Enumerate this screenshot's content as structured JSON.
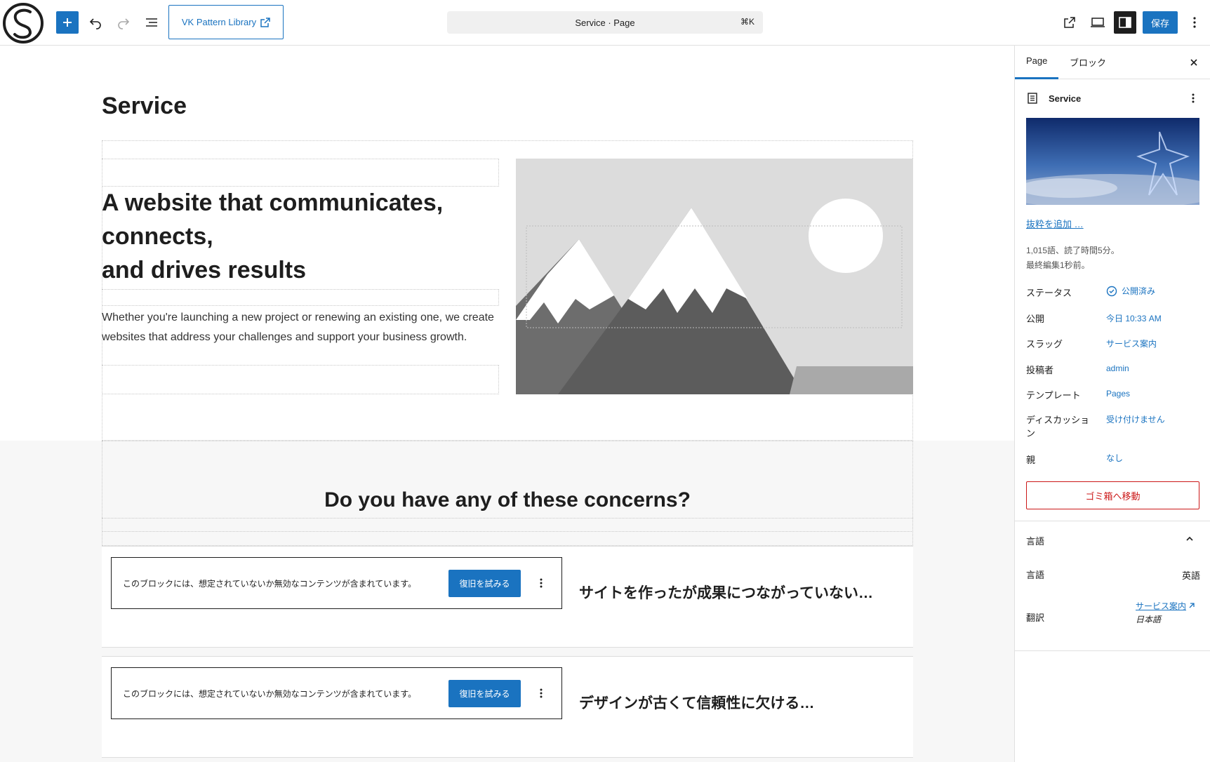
{
  "toolbar": {
    "add_label": "+",
    "vk_label": "VK Pattern Library",
    "command_title": "Service · Page",
    "command_shortcut": "⌘K",
    "save_label": "保存"
  },
  "canvas": {
    "page_title": "Service",
    "hero": {
      "heading_lines": [
        "A website that communicates,",
        "connects,",
        "and drives results"
      ],
      "paragraph": "Whether you're launching a new project or renewing an existing one, we create websites that address your challenges and support your business growth."
    },
    "concerns_heading": "Do you have any of these concerns?",
    "cards": [
      {
        "invalid_text": "このブロックには、想定されていないか無効なコンテンツが含まれています。",
        "restore_label": "復旧を試みる",
        "heading": "サイトを作ったが成果につながっていない…"
      },
      {
        "invalid_text": "このブロックには、想定されていないか無効なコンテンツが含まれています。",
        "restore_label": "復旧を試みる",
        "heading": "デザインが古くて信頼性に欠ける…"
      }
    ]
  },
  "sidebar": {
    "tabs": [
      "Page",
      "ブロック"
    ],
    "doc_title": "Service",
    "add_excerpt": "抜粋を追加 …",
    "word_count": "1,015語、読了時間5分。",
    "last_edited": "最終編集1秒前。",
    "rows": [
      {
        "label": "ステータス",
        "value": "公開済み"
      },
      {
        "label": "公開",
        "value": "今日 10:33 AM"
      },
      {
        "label": "スラッグ",
        "value": "サービス案内"
      },
      {
        "label": "投稿者",
        "value": "admin"
      },
      {
        "label": "テンプレート",
        "value": "Pages"
      },
      {
        "label": "ディスカッション",
        "value": "受け付けません"
      },
      {
        "label": "親",
        "value": "なし"
      }
    ],
    "trash_label": "ゴミ箱へ移動",
    "language_section": {
      "title": "言語",
      "language_label": "言語",
      "language_value": "英語",
      "translation_label": "翻訳",
      "translation_link": "サービス案内",
      "translation_lang": "日本語"
    }
  },
  "colors": {
    "accent": "#1a73c0",
    "danger": "#cc1818",
    "text": "#1e1e1e"
  }
}
